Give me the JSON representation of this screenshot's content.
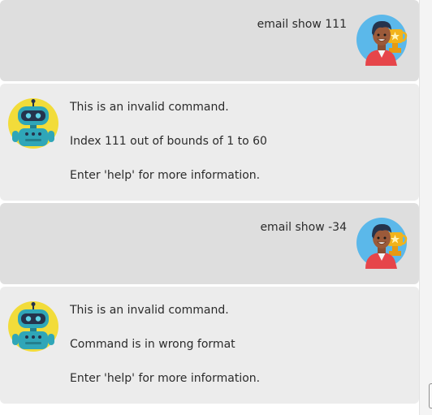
{
  "conversation": [
    {
      "role": "user",
      "avatar_icon": "user-avatar-trophy-icon",
      "text": "email show 111"
    },
    {
      "role": "bot",
      "avatar_icon": "robot-avatar-icon",
      "lines": [
        "This is an invalid command.",
        "Index 111 out of bounds of 1 to 60",
        "Enter 'help' for more information."
      ]
    },
    {
      "role": "user",
      "avatar_icon": "user-avatar-trophy-icon",
      "text": "email show -34"
    },
    {
      "role": "bot",
      "avatar_icon": "robot-avatar-icon",
      "lines": [
        "This is an invalid command.",
        "Command is in wrong format",
        "Enter 'help' for more information."
      ]
    }
  ],
  "colors": {
    "user_bubble": "#dedede",
    "bot_bubble": "#ececec",
    "text": "#2b2b2b",
    "avatar_user_bg": "#5bb8ea",
    "avatar_bot_bg": "#f2dc3a",
    "robot_body": "#2fa6b8",
    "trophy": "#f2b31b"
  }
}
